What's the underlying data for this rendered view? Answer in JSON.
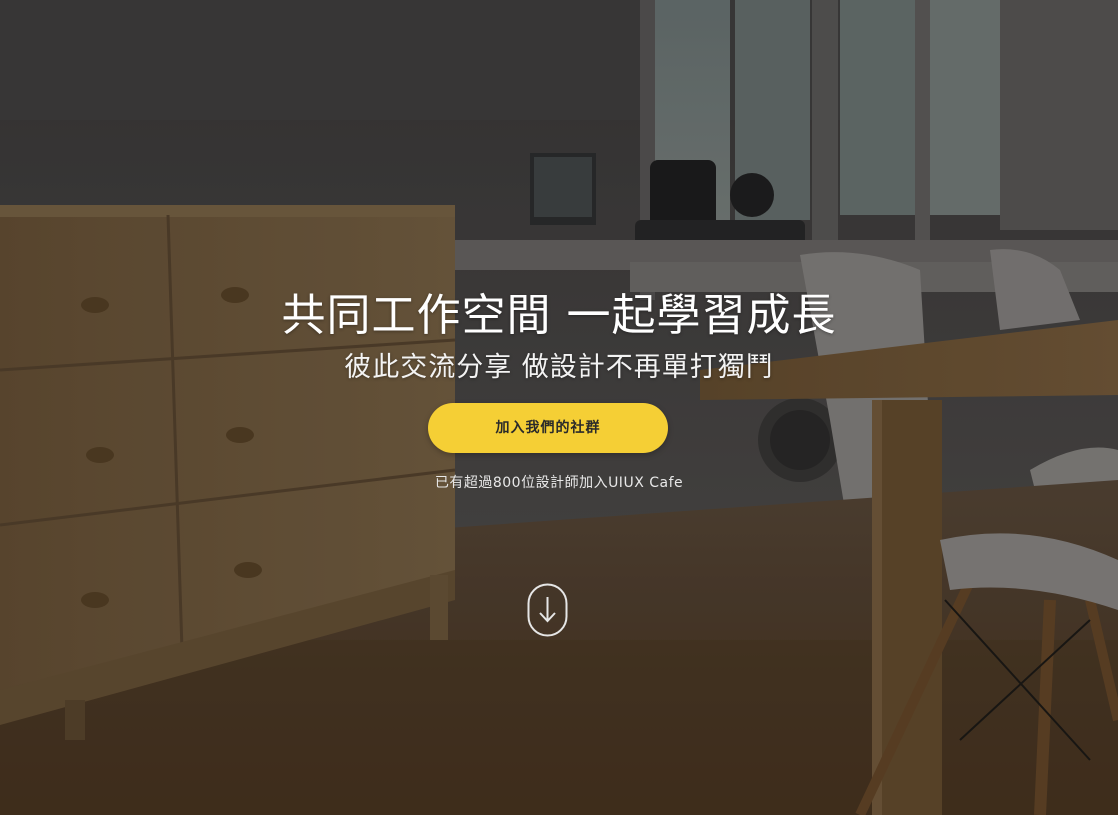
{
  "hero": {
    "title": "共同工作空間 一起學習成長",
    "subtitle": "彼此交流分享 做設計不再單打獨鬥",
    "cta_label": "加入我們的社群",
    "note": "已有超過800位設計師加入UIUX Cafe",
    "scroll_icon": "arrow-down-circle-icon"
  },
  "colors": {
    "cta_background": "#f5cf35",
    "cta_text": "#2a2a2a",
    "text": "#ffffff"
  }
}
